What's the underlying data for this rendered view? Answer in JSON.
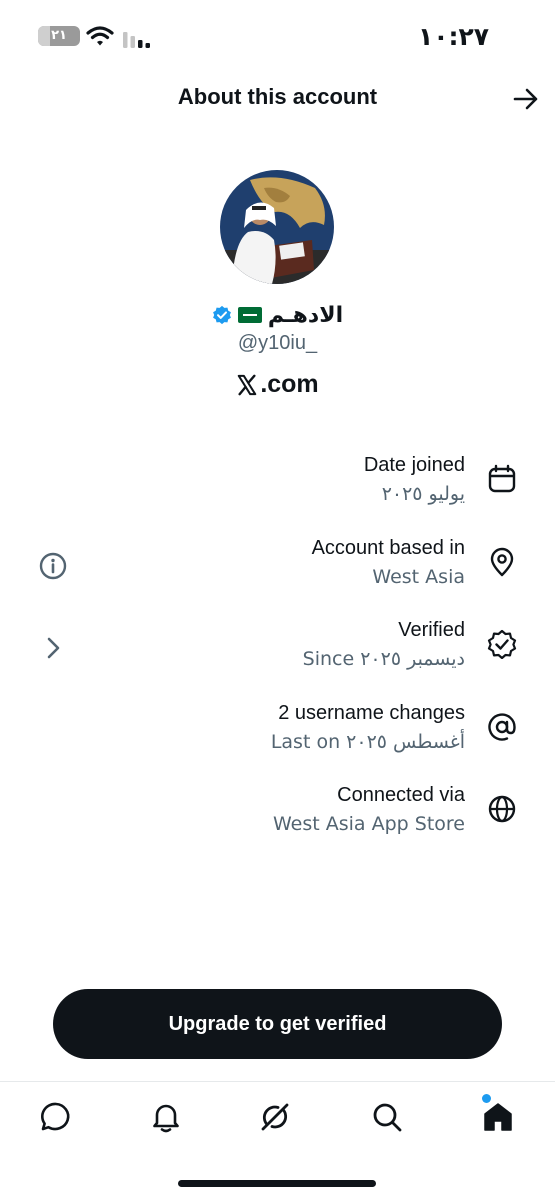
{
  "status_bar": {
    "time": "١٠:٢٧",
    "battery_level": "٢١"
  },
  "header": {
    "title": "About this account"
  },
  "profile": {
    "display_name": "الادهـم",
    "handle": "@y10iu_",
    "site": ".com"
  },
  "info_rows": [
    {
      "label": "Date joined",
      "value": "يوليو ٢٠٢٥",
      "icon": "calendar-icon"
    },
    {
      "label": "Account based in",
      "value": "West Asia",
      "icon": "location-pin-icon"
    },
    {
      "label": "Verified",
      "value": "Since ديسمبر ٢٠٢٥",
      "icon": "verified-badge-icon"
    },
    {
      "label": "2 username changes",
      "value": "Last on أغسطس ٢٠٢٥",
      "icon": "at-sign-icon"
    },
    {
      "label": "Connected via",
      "value": "West Asia App Store",
      "icon": "globe-icon"
    }
  ],
  "upgrade_button": {
    "label": "Upgrade to get verified"
  },
  "tab_bar": {
    "items": [
      "chat-icon",
      "bell-icon",
      "grok-icon",
      "search-icon",
      "home-icon"
    ]
  },
  "colors": {
    "text": "#0f1419",
    "secondary": "#536471",
    "accent": "#1d9bf0",
    "flag": "#006c35"
  }
}
